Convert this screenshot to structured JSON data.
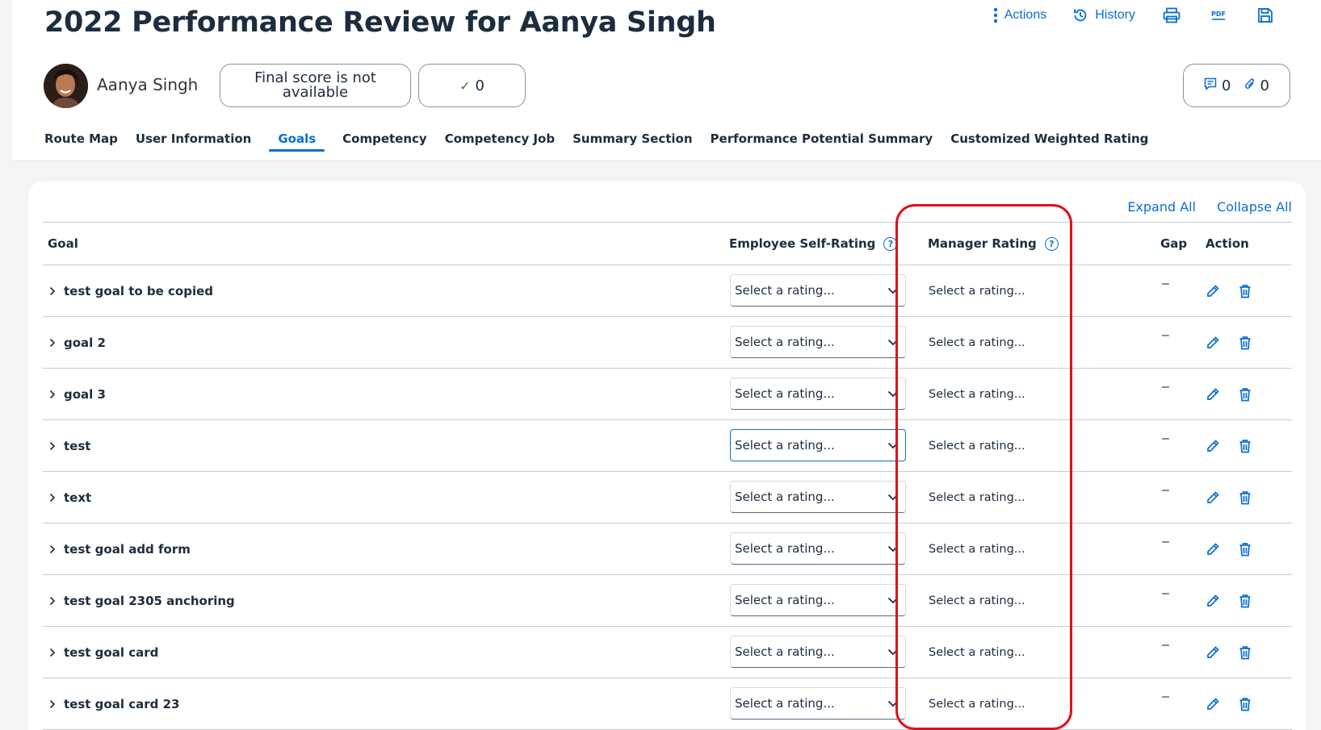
{
  "page": {
    "title": "2022 Performance Review for Aanya Singh"
  },
  "toolbar": {
    "actions_label": "Actions",
    "history_label": "History",
    "items": [
      {
        "icon": "more-vertical-icon"
      },
      {
        "icon": "history-icon"
      },
      {
        "icon": "print-icon"
      },
      {
        "icon": "pdf-icon"
      },
      {
        "icon": "save-icon"
      }
    ],
    "accent_color": "#0a6ed1"
  },
  "employee": {
    "name": "Aanya Singh",
    "final_score": "Final score is not available",
    "approvals_count": "0",
    "comments_count": "0",
    "attachments_count": "0"
  },
  "tabs": [
    {
      "label": "Route Map"
    },
    {
      "label": "User Information"
    },
    {
      "label": "Goals",
      "active": true
    },
    {
      "label": "Competency"
    },
    {
      "label": "Competency Job"
    },
    {
      "label": "Summary Section"
    },
    {
      "label": "Performance Potential Summary"
    },
    {
      "label": "Customized Weighted Rating"
    }
  ],
  "goals_section": {
    "expand_all": "Expand All",
    "collapse_all": "Collapse All",
    "columns": {
      "goal": "Goal",
      "self_rating": "Employee Self-Rating",
      "manager_rating": "Manager Rating",
      "gap": "Gap",
      "action": "Action"
    },
    "rows": [
      {
        "goal": "test goal to be copied",
        "self_rating": "Select a rating...",
        "manager_rating": "Select a rating...",
        "gap": "–"
      },
      {
        "goal": "goal 2",
        "self_rating": "Select a rating...",
        "manager_rating": "Select a rating...",
        "gap": "–"
      },
      {
        "goal": "goal 3",
        "self_rating": "Select a rating...",
        "manager_rating": "Select a rating...",
        "gap": "–"
      },
      {
        "goal": "test",
        "self_rating": "Select a rating...",
        "manager_rating": "Select a rating...",
        "gap": "–",
        "focused": true
      },
      {
        "goal": "text",
        "self_rating": "Select a rating...",
        "manager_rating": "Select a rating...",
        "gap": "–"
      },
      {
        "goal": "test goal add form",
        "self_rating": "Select a rating...",
        "manager_rating": "Select a rating...",
        "gap": "–"
      },
      {
        "goal": "test goal 2305 anchoring",
        "self_rating": "Select a rating...",
        "manager_rating": "Select a rating...",
        "gap": "–"
      },
      {
        "goal": "test goal card",
        "self_rating": "Select a rating...",
        "manager_rating": "Select a rating...",
        "gap": "–"
      },
      {
        "goal": "test goal card 23",
        "self_rating": "Select a rating...",
        "manager_rating": "Select a rating...",
        "gap": "–"
      }
    ]
  },
  "annotation": {
    "highlight_color": "#e0101a"
  }
}
